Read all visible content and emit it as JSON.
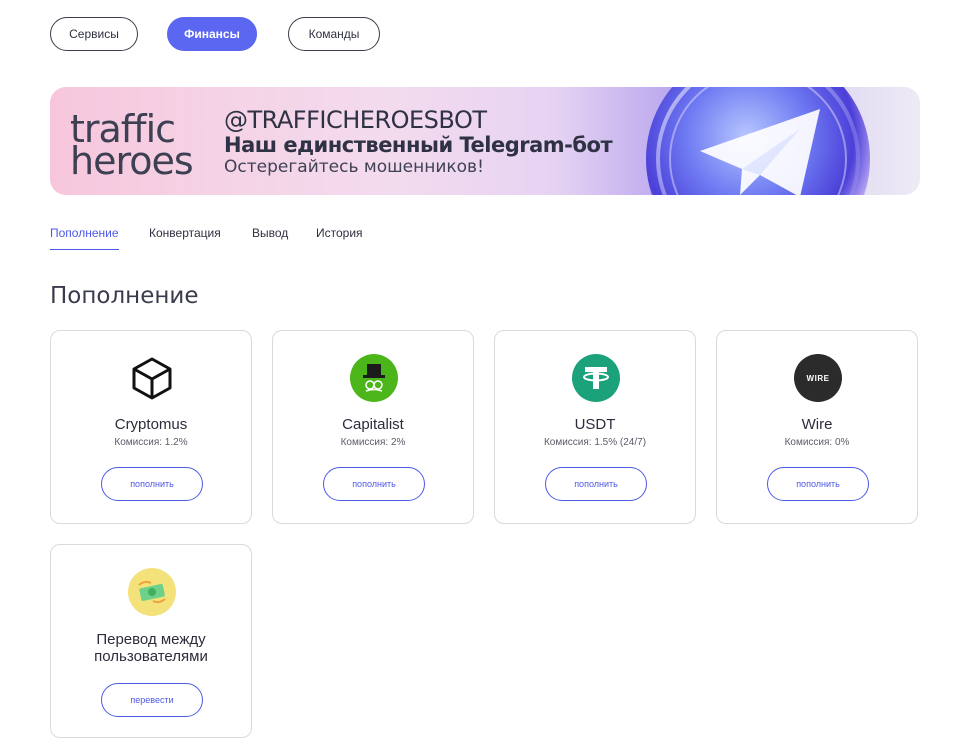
{
  "topnav": [
    {
      "label": "Сервисы",
      "active": false
    },
    {
      "label": "Финансы",
      "active": true
    },
    {
      "label": "Команды",
      "active": false
    }
  ],
  "banner": {
    "brand_line1": "traffic",
    "brand_line2": "heroes",
    "handle": "@TRAFFICHEROESBOT",
    "title": "Наш единственный Telegram-бот",
    "subtitle": "Остерегайтесь мошенников!"
  },
  "tabs": [
    {
      "label": "Пополнение",
      "active": true
    },
    {
      "label": "Конвертация",
      "active": false
    },
    {
      "label": "Вывод",
      "active": false
    },
    {
      "label": "История",
      "active": false
    }
  ],
  "section_title": "Пополнение",
  "methods": [
    {
      "name": "Cryptomus",
      "fee": "Комиссия: 1.2%",
      "button": "пополнить",
      "icon": "cryptomus-cube-icon"
    },
    {
      "name": "Capitalist",
      "fee": "Комиссия: 2%",
      "button": "пополнить",
      "icon": "capitalist-hat-icon",
      "color": "#4cb51a"
    },
    {
      "name": "USDT",
      "fee": "Комиссия: 1.5% (24/7)",
      "button": "пополнить",
      "icon": "tether-icon",
      "color": "#1ba27a"
    },
    {
      "name": "Wire",
      "fee": "Комиссия: 0%",
      "button": "пополнить",
      "icon": "wire-transfer-icon",
      "icon_text": "WIRE",
      "color": "#2b2b2b"
    }
  ],
  "transfer": {
    "name": "Перевод между пользователями",
    "button": "перевести",
    "icon": "money-transfer-icon",
    "color": "#f3e27a"
  },
  "colors": {
    "accent": "#5b67f0",
    "link": "#4c59e6"
  }
}
